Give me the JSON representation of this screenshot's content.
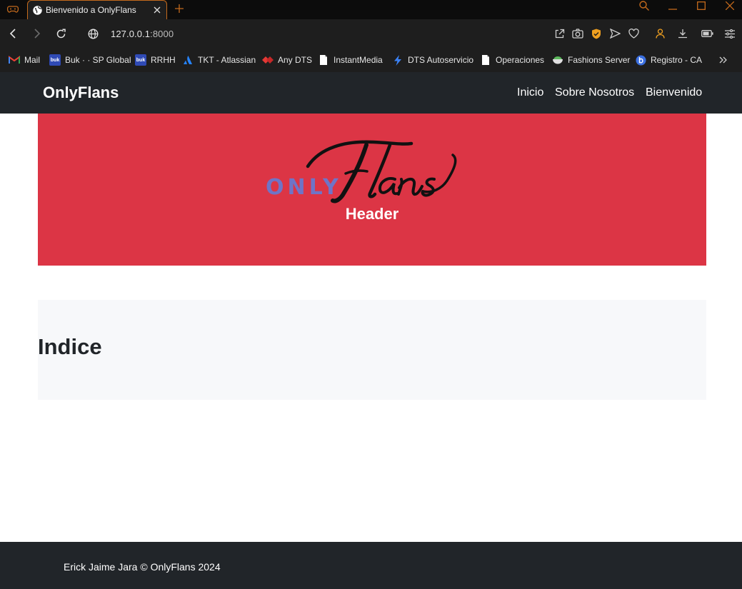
{
  "browser": {
    "tab_title": "Bienvenido a OnlyFlans",
    "url_host": "127.0.0.1",
    "url_port": ":8000",
    "accent_color": "#c46a1c",
    "bookmarks": [
      {
        "label": "Mail",
        "icon": "gmail-icon"
      },
      {
        "label": "Buk · · SP Global",
        "icon": "buk-icon"
      },
      {
        "label": "RRHH",
        "icon": "buk-icon"
      },
      {
        "label": "TKT - Atlassian",
        "icon": "atlassian-icon"
      },
      {
        "label": "Any DTS",
        "icon": "anydts-icon"
      },
      {
        "label": "InstantMedia",
        "icon": "page-icon"
      },
      {
        "label": "DTS Autoservicio",
        "icon": "bolt-icon"
      },
      {
        "label": "Operaciones",
        "icon": "page-icon"
      },
      {
        "label": "Fashions Server",
        "icon": "bowl-icon"
      },
      {
        "label": "Registro - CA",
        "icon": "b-circle-icon"
      }
    ]
  },
  "site": {
    "brand": "OnlyFlans",
    "nav": [
      "Inicio",
      "Sobre Nosotros",
      "Bienvenido"
    ],
    "hero": {
      "logo_only": "ONLY",
      "logo_flans": "Flans",
      "title": "Header",
      "color": "#dc3545"
    },
    "index_title": "Indice",
    "footer": "Erick Jaime Jara © OnlyFlans 2024",
    "dark_color": "#212529"
  }
}
